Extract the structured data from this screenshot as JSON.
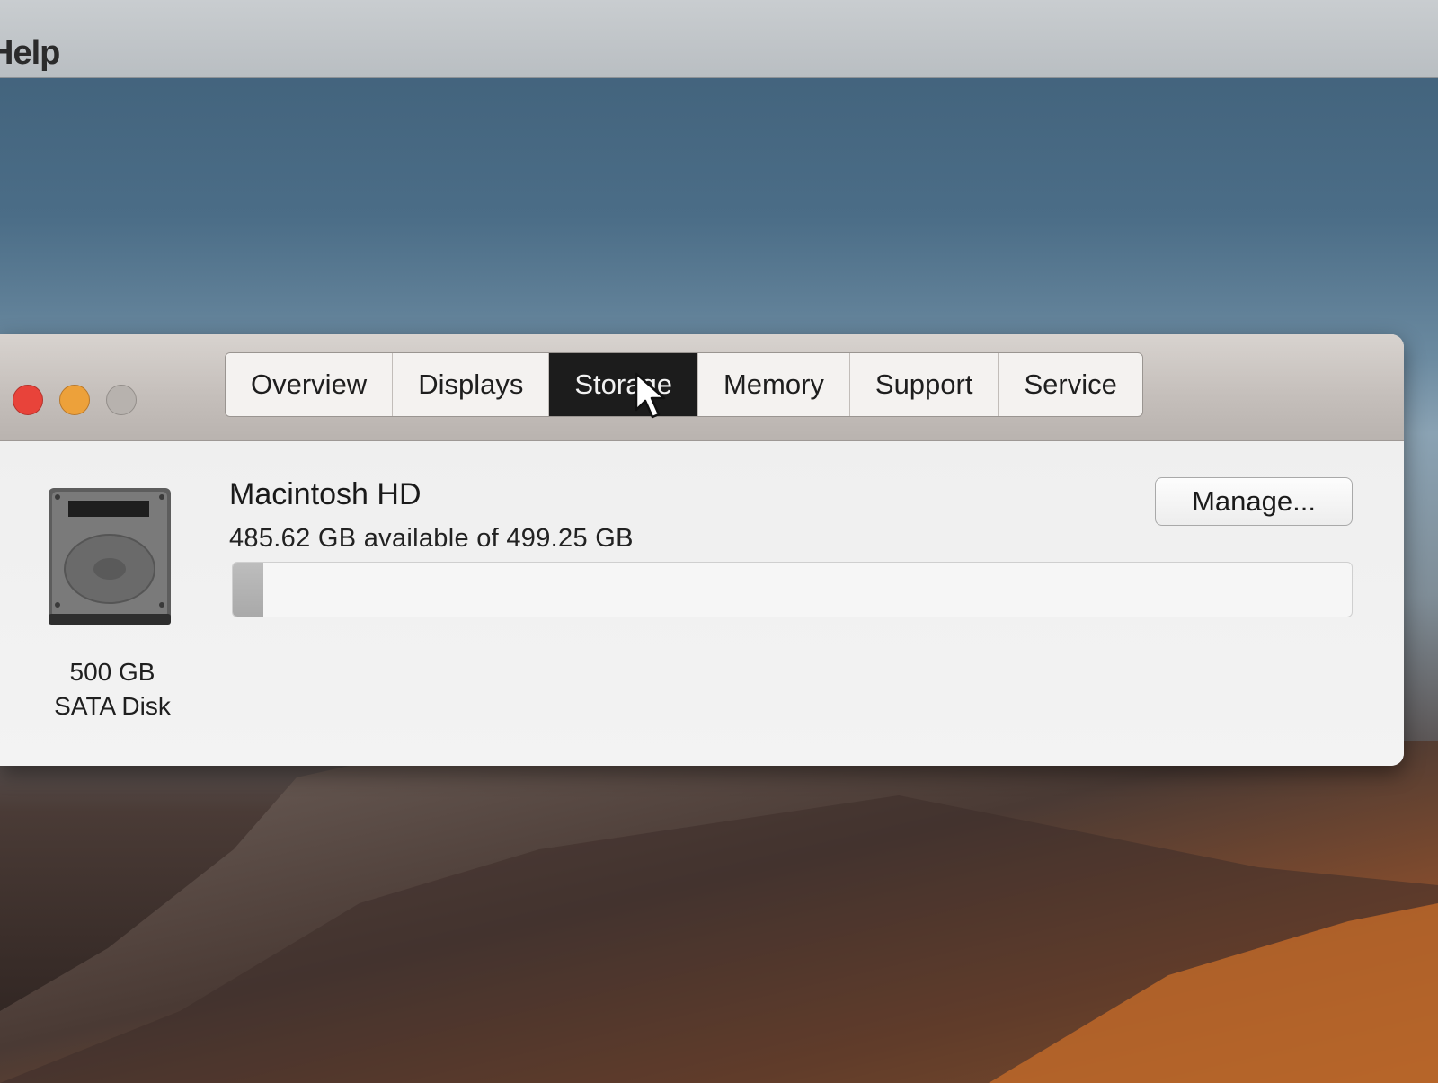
{
  "menubar": {
    "help_label": "Help"
  },
  "window": {
    "tabs": [
      {
        "label": "Overview",
        "active": false
      },
      {
        "label": "Displays",
        "active": false
      },
      {
        "label": "Storage",
        "active": true
      },
      {
        "label": "Memory",
        "active": false
      },
      {
        "label": "Support",
        "active": false
      },
      {
        "label": "Service",
        "active": false
      }
    ]
  },
  "storage": {
    "disk_capacity": "500 GB",
    "disk_type": "SATA Disk",
    "volume_name": "Macintosh HD",
    "availability": "485.62 GB available of 499.25 GB",
    "used_fraction": 0.027,
    "manage_label": "Manage..."
  },
  "colors": {
    "close": "#e8433a",
    "minimize": "#eda13a",
    "zoom": "#b7b2ae",
    "active_tab": "#1c1c1c"
  }
}
